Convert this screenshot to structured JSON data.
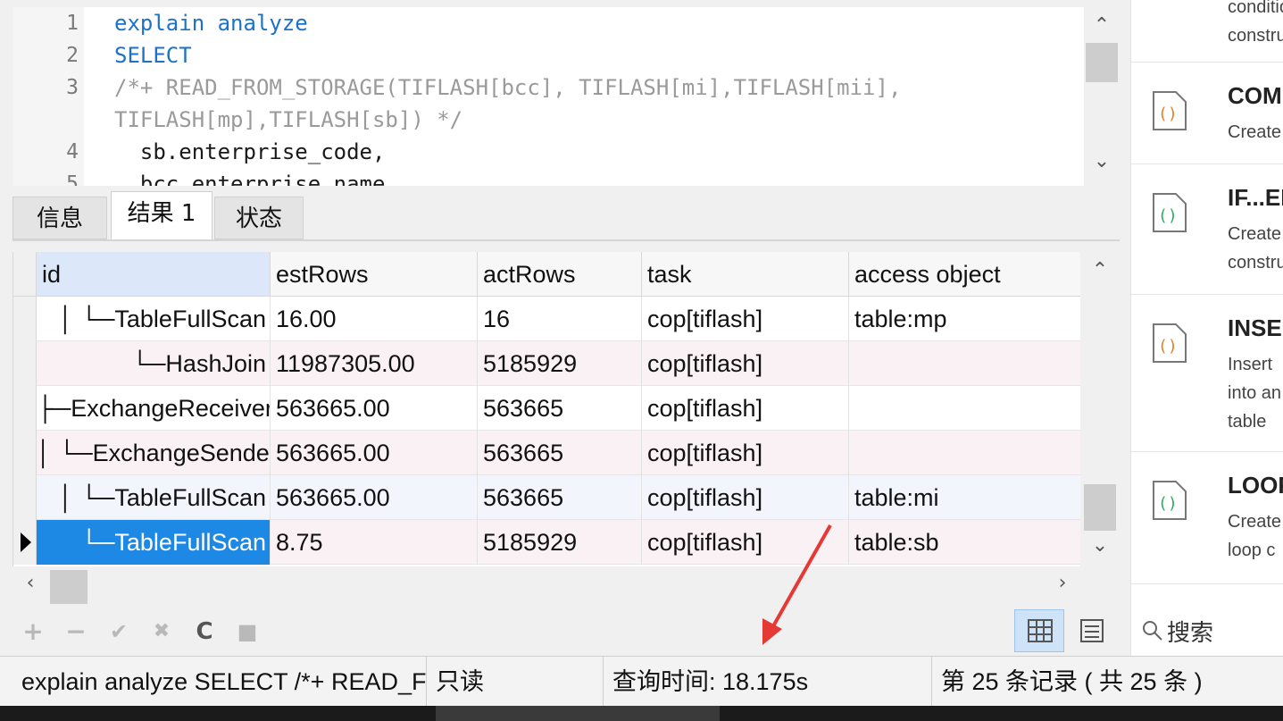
{
  "editor": {
    "lines": [
      {
        "num": "1",
        "parts": [
          {
            "cls": "kw",
            "text": "explain analyze"
          }
        ]
      },
      {
        "num": "2",
        "parts": [
          {
            "cls": "kw",
            "text": "SELECT"
          }
        ]
      },
      {
        "num": "3",
        "parts": [
          {
            "cls": "cm",
            "text": "/*+ READ_FROM_STORAGE(TIFLASH[bcc], TIFLASH[mi],TIFLASH[mii],"
          }
        ]
      },
      {
        "num": "",
        "parts": [
          {
            "cls": "cm",
            "text": "TIFLASH[mp],TIFLASH[sb]) */"
          }
        ]
      },
      {
        "num": "4",
        "parts": [
          {
            "cls": "tx",
            "text": "  sb.enterprise_code,"
          }
        ]
      },
      {
        "num": "5",
        "parts": [
          {
            "cls": "tx",
            "text": "  bcc.enterprise_name,"
          }
        ]
      }
    ]
  },
  "tabs": [
    {
      "label": "信息",
      "active": false
    },
    {
      "label": "结果 1",
      "active": true
    },
    {
      "label": "状态",
      "active": false
    }
  ],
  "grid": {
    "columns": [
      "id",
      "estRows",
      "actRows",
      "task",
      "access object"
    ],
    "rows": [
      {
        "id": "│   └─TableFullScan",
        "estRows": "16.00",
        "actRows": "16",
        "task": "cop[tiflash]",
        "access": "table:mp"
      },
      {
        "id": "└─HashJoin",
        "estRows": "11987305.00",
        "actRows": "5185929",
        "task": "cop[tiflash]",
        "access": ""
      },
      {
        "id": "├─ExchangeReceiver",
        "estRows": "563665.00",
        "actRows": "563665",
        "task": "cop[tiflash]",
        "access": ""
      },
      {
        "id": "│ └─ExchangeSender",
        "estRows": "563665.00",
        "actRows": "563665",
        "task": "cop[tiflash]",
        "access": ""
      },
      {
        "id": "│   └─TableFullScan",
        "estRows": "563665.00",
        "actRows": "563665",
        "task": "cop[tiflash]",
        "access": "table:mi"
      },
      {
        "id": "└─TableFullScan",
        "estRows": "8.75",
        "actRows": "5185929",
        "task": "cop[tiflash]",
        "access": "table:sb"
      }
    ]
  },
  "toolbar": {
    "add": "+",
    "remove": "−",
    "apply": "✔",
    "cancel": "✖",
    "refresh": "C",
    "stop": "■"
  },
  "status": {
    "query": "explain analyze SELECT /*+ READ_FROM_STORAGE",
    "readonly": "只读",
    "query_time": "查询时间: 18.175s",
    "record": "第 25 条记录 ( 共 25 条 )"
  },
  "snippets": [
    {
      "title": "",
      "desc": [
        "condition",
        "construct"
      ],
      "icon_color": "#e67e22"
    },
    {
      "title": "COMMENT",
      "desc": [
        "Create"
      ],
      "icon_color": "#e67e22"
    },
    {
      "title": "IF...ELSE",
      "desc": [
        "Create",
        "construct"
      ],
      "icon_color": "#27ae60"
    },
    {
      "title": "INSERT",
      "desc": [
        "Insert",
        "into an",
        "table"
      ],
      "icon_color": "#e67e22"
    },
    {
      "title": "LOOP",
      "desc": [
        "Create",
        "loop c"
      ],
      "icon_color": "#27ae60"
    }
  ],
  "search": {
    "label": "搜索"
  },
  "colors": {
    "accent": "#1e88e5",
    "keyword": "#1c72c8",
    "comment": "#9a9a9a",
    "annotation": "#e53935"
  }
}
